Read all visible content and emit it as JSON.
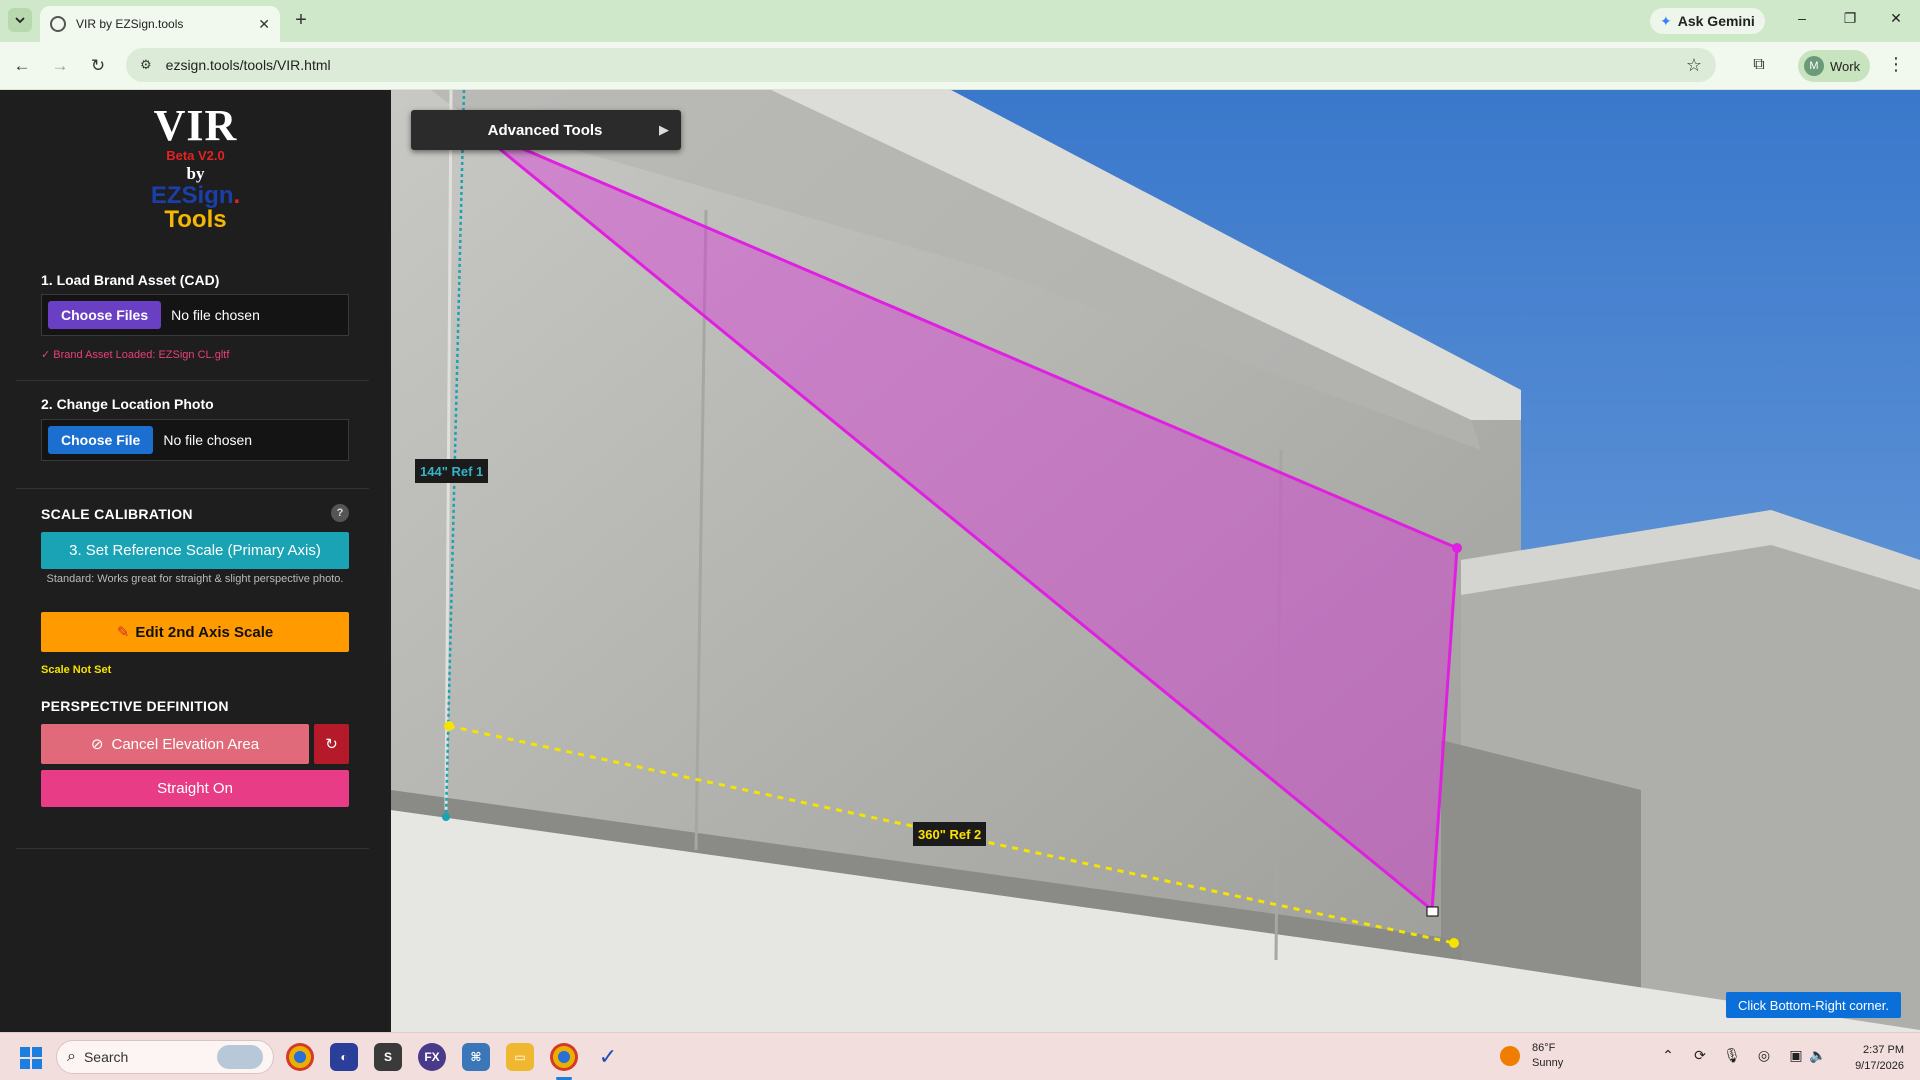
{
  "browser": {
    "tab_title": "VIR by EZSign.tools",
    "tab_close": "✕",
    "new_tab": "+",
    "ask_gemini": "Ask Gemini",
    "url": "ezsign.tools/tools/VIR.html",
    "profile_initial": "M",
    "profile_name": "Work",
    "window_controls": [
      "–",
      "❐",
      "✕"
    ]
  },
  "sidebar": {
    "logo": {
      "title": "VIR",
      "version": "Beta V2.0",
      "by": "by",
      "brand_main": "EZSign",
      "brand_dot": ".",
      "brand_sub": "Tools"
    },
    "load_asset": {
      "label": "1. Load Brand Asset (CAD)",
      "button": "Choose Files",
      "status": "No file chosen",
      "loaded_msg": "✓ Brand Asset Loaded: EZSign CL.gltf"
    },
    "location_photo": {
      "label": "2. Change Location Photo",
      "button": "Choose File",
      "status": "No file chosen"
    },
    "scale_calibration": {
      "heading": "SCALE CALIBRATION",
      "help": "?",
      "ref_button": "3. Set Reference Scale (Primary Axis)",
      "ref_desc": "Standard: Works great for straight & slight perspective photo.",
      "edit_axis_button": "Edit 2nd Axis Scale",
      "edit_axis_icon": "✎",
      "status": "Scale Not Set"
    },
    "perspective": {
      "heading": "PERSPECTIVE DEFINITION",
      "cancel_icon": "⊘",
      "cancel_button": "Cancel Elevation Area",
      "reset_icon": "↻",
      "straight_button": "Straight On"
    }
  },
  "canvas": {
    "advanced_tools": "Advanced Tools",
    "advanced_arrow": "▶",
    "ref1_label": "144\" Ref 1",
    "ref2_label": "360\" Ref 2",
    "hint": "Click Bottom-Right corner.",
    "colors": {
      "quad": "#e020e0",
      "ref1": "#1aa3b5",
      "ref2": "#f5e300",
      "sky": "#2f6fc4"
    }
  },
  "taskbar": {
    "search_placeholder": "Search",
    "apps": [
      "chrome-icon",
      "app-icon",
      "s-app-icon",
      "fx-app-icon",
      "python-icon",
      "folder-icon",
      "chrome-active-icon",
      "vir-app-icon"
    ],
    "weather_temp": "86°F",
    "weather_desc": "Sunny",
    "time": "2:37 PM",
    "date": "9/17/2026"
  }
}
